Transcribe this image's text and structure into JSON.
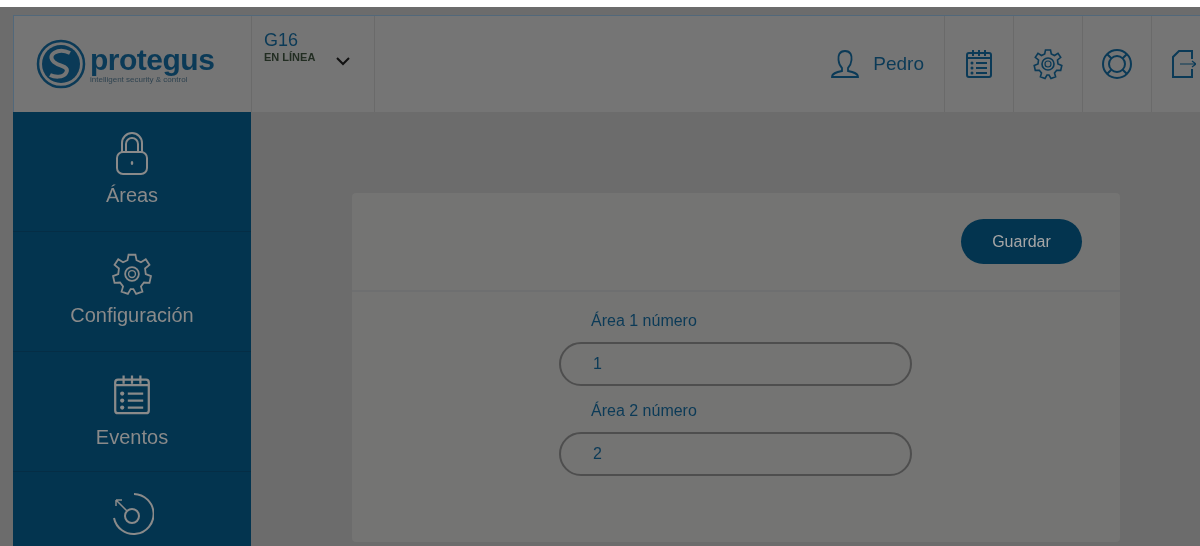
{
  "logo": {
    "name": "protegus",
    "tagline": "intelligent security & control"
  },
  "device": {
    "name": "G16",
    "status": "EN LÍNEA"
  },
  "user": {
    "name": "Pedro"
  },
  "header_icons": [
    {
      "kind": "calendar"
    },
    {
      "kind": "gear"
    },
    {
      "kind": "lifebuoy"
    },
    {
      "kind": "logout"
    }
  ],
  "sidebar": {
    "items": [
      {
        "kind": "lock",
        "label": "Áreas"
      },
      {
        "kind": "gear",
        "label": "Configuración"
      },
      {
        "kind": "calendar",
        "label": "Eventos"
      },
      {
        "kind": "dial"
      }
    ]
  },
  "form": {
    "save_button": "Guardar",
    "fields": [
      {
        "label": "Área 1 número",
        "value": "1"
      },
      {
        "label": "Área 2 número",
        "value": "2"
      }
    ]
  }
}
